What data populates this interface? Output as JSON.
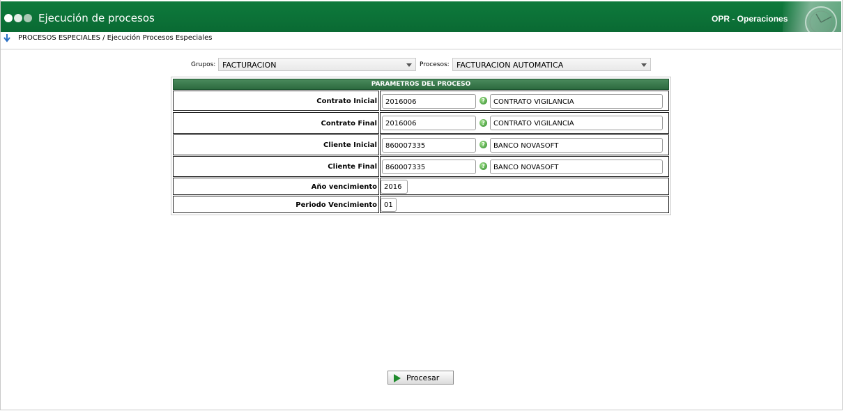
{
  "header": {
    "title": "Ejecución de procesos",
    "module": "OPR - Operaciones",
    "colors": {
      "header_green": "#0e7a3c",
      "accent_green": "#1f8a2c"
    }
  },
  "breadcrumb": {
    "text": "PROCESOS ESPECIALES / Ejecución Procesos Especiales"
  },
  "filters": {
    "groups_label": "Grupos:",
    "groups_value": "FACTURACION",
    "processes_label": "Procesos:",
    "processes_value": "FACTURACION AUTOMATICA"
  },
  "params": {
    "title": "PARAMETROS DEL PROCESO",
    "rows": [
      {
        "label": "Contrato Inicial",
        "value": "2016006",
        "description": "CONTRATO VIGILANCIA"
      },
      {
        "label": "Contrato Final",
        "value": "2016006",
        "description": "CONTRATO VIGILANCIA"
      },
      {
        "label": "Cliente Inicial",
        "value": "860007335",
        "description": "BANCO NOVASOFT"
      },
      {
        "label": "Cliente Final",
        "value": "860007335",
        "description": "BANCO NOVASOFT"
      },
      {
        "label": "Año vencimiento",
        "value": "2016"
      },
      {
        "label": "Periodo Vencimiento",
        "value": "01"
      }
    ]
  },
  "actions": {
    "process_label": "Procesar"
  }
}
